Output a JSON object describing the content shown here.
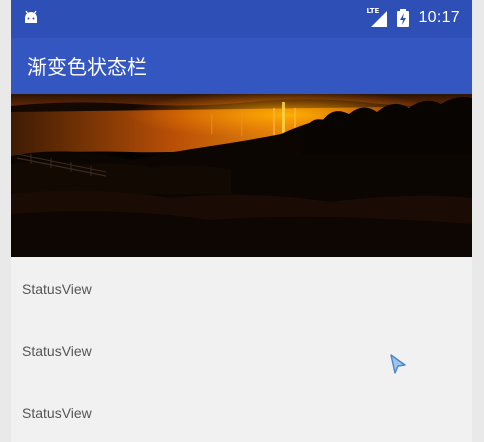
{
  "status_bar": {
    "network": "LTE",
    "time": "10:17",
    "color": "#2d4fb6"
  },
  "toolbar": {
    "title": "渐变色状态栏",
    "color": "#3356c1"
  },
  "banner": {
    "icon": "sunset-landscape-image"
  },
  "list": {
    "items": [
      {
        "label": "StatusView"
      },
      {
        "label": "StatusView"
      },
      {
        "label": "StatusView"
      }
    ]
  },
  "cursor": {
    "icon": "pointer-arrow-icon"
  }
}
